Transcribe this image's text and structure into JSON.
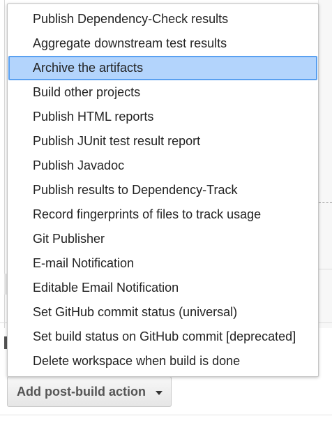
{
  "menu": {
    "items": [
      {
        "label": "Publish Dependency-Check results",
        "selected": false
      },
      {
        "label": "Aggregate downstream test results",
        "selected": false
      },
      {
        "label": "Archive the artifacts",
        "selected": true
      },
      {
        "label": "Build other projects",
        "selected": false
      },
      {
        "label": "Publish HTML reports",
        "selected": false
      },
      {
        "label": "Publish JUnit test result report",
        "selected": false
      },
      {
        "label": "Publish Javadoc",
        "selected": false
      },
      {
        "label": "Publish results to Dependency-Track",
        "selected": false
      },
      {
        "label": "Record fingerprints of files to track usage",
        "selected": false
      },
      {
        "label": "Git Publisher",
        "selected": false
      },
      {
        "label": "E-mail Notification",
        "selected": false
      },
      {
        "label": "Editable Email Notification",
        "selected": false
      },
      {
        "label": "Set GitHub commit status (universal)",
        "selected": false
      },
      {
        "label": "Set build status on GitHub commit [deprecated]",
        "selected": false
      },
      {
        "label": "Delete workspace when build is done",
        "selected": false
      }
    ]
  },
  "add_button": {
    "label": "Add post-build action",
    "icon": "caret-down-icon"
  },
  "colors": {
    "selected_bg": "#b3d4fc",
    "selected_border": "#5aa0f0",
    "text": "#222222",
    "button_text": "#555555"
  }
}
